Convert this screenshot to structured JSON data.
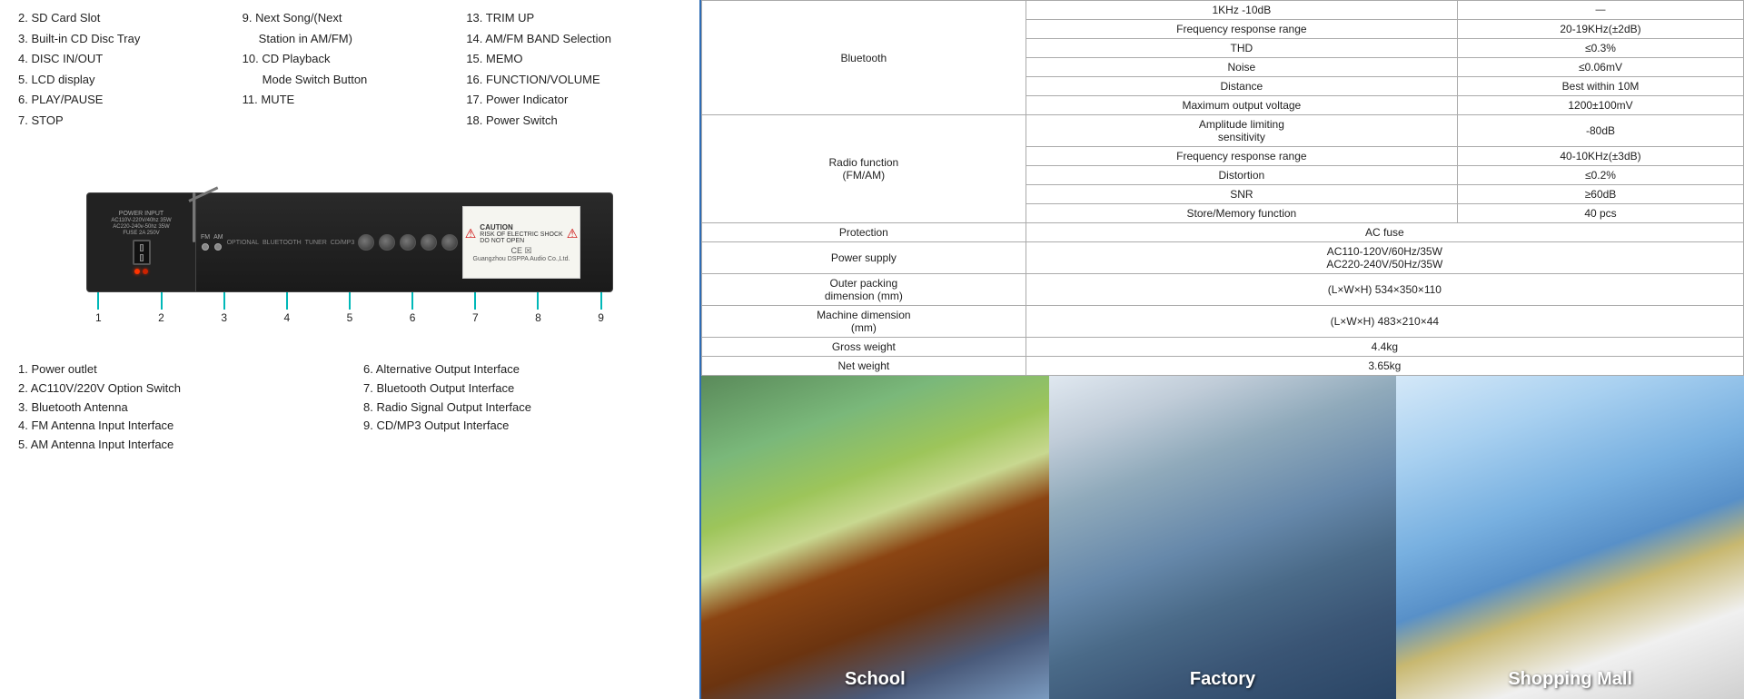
{
  "left": {
    "features_col1": [
      "2. SD Card Slot",
      "3. Built-in CD Disc Tray",
      "4. DISC IN/OUT",
      "5. LCD display",
      "6. PLAY/PAUSE",
      "7. STOP"
    ],
    "features_col2": [
      "9. Next Song/(Next",
      "    Station in AM/FM)",
      "10. CD Playback",
      "    Mode Switch Button",
      "11. MUTE"
    ],
    "features_col3": [
      "13. TRIM UP",
      "14. AM/FM BAND Selection",
      "15. MEMO",
      "16.  FUNCTION/VOLUME",
      "17. Power Indicator",
      "18. Power Switch"
    ],
    "back_labels_col1": [
      "1. Power outlet",
      "2. AC110V/220V Option Switch",
      "3. Bluetooth Antenna",
      "4. FM Antenna Input Interface",
      "5. AM Antenna Input Interface"
    ],
    "back_labels_col2": [
      "6. Alternative Output Interface",
      "7. Bluetooth Output Interface",
      "8. Radio Signal Output Interface",
      "9. CD/MP3 Output Interface"
    ],
    "connector_nums": [
      "1",
      "2",
      "3",
      "4",
      "5",
      "6",
      "7",
      "8",
      "9"
    ]
  },
  "specs": {
    "rows": [
      {
        "cat": "Bluetooth",
        "name": "Frequency response range",
        "val": "20-19KHz(±2dB)"
      },
      {
        "cat": "",
        "name": "THD",
        "val": "≤0.3%"
      },
      {
        "cat": "",
        "name": "Noise",
        "val": "≤0.06mV"
      },
      {
        "cat": "",
        "name": "Distance",
        "val": "Best within 10M"
      },
      {
        "cat": "",
        "name": "Maximum output voltage",
        "val": "1200±100mV"
      },
      {
        "cat": "",
        "name": "Amplitude limiting sensitivity",
        "val": "-80dB"
      },
      {
        "cat": "Radio function (FM/AM)",
        "name": "Frequency response range",
        "val": "40-10KHz(±3dB)"
      },
      {
        "cat": "",
        "name": "Distortion",
        "val": "≤0.2%"
      },
      {
        "cat": "",
        "name": "SNR",
        "val": "≥60dB"
      },
      {
        "cat": "",
        "name": "Store/Memory function",
        "val": "40 pcs"
      },
      {
        "cat": "Protection",
        "name": "",
        "val": "AC fuse"
      },
      {
        "cat": "Power supply",
        "name": "",
        "val": "AC110-120V/60Hz/35W\nAC220-240V/50Hz/35W"
      },
      {
        "cat": "Outer packing dimension (mm)",
        "name": "",
        "val": "(L×W×H) 534×350×110"
      },
      {
        "cat": "Machine dimension (mm)",
        "name": "",
        "val": "(L×W×H) 483×210×44"
      },
      {
        "cat": "Gross weight",
        "name": "",
        "val": "4.4kg"
      },
      {
        "cat": "Net weight",
        "name": "",
        "val": "3.65kg"
      }
    ]
  },
  "images": [
    {
      "label": "School",
      "bg1": "#4a7c4e",
      "bg2": "#8bc34a"
    },
    {
      "label": "Factory",
      "bg1": "#5a8ab0",
      "bg2": "#4682b4"
    },
    {
      "label": "Shopping Mall",
      "bg1": "#c0d8f0",
      "bg2": "#87ceeb"
    }
  ],
  "caution": {
    "title": "CAUTION",
    "subtitle": "RISK OF ELECTRIC SHOCK",
    "instruction": "DO NOT OPEN",
    "brand": "Guangzhou DSPPA Audio Co.,Ltd."
  },
  "device_labels": {
    "power_input": "POWER INPUT",
    "fm": "FM",
    "am": "AM"
  }
}
